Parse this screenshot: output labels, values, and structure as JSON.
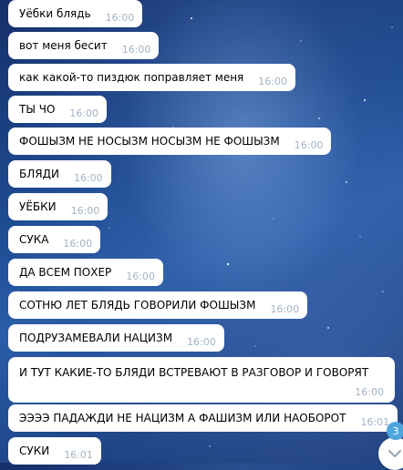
{
  "messages": [
    {
      "text": "Уёбки блядь",
      "time": "16:00"
    },
    {
      "text": "вот меня бесит",
      "time": "16:00"
    },
    {
      "text": "как какой-то пиздюк поправляет меня",
      "time": "16:00"
    },
    {
      "text": "ТЫ ЧО",
      "time": "16:00"
    },
    {
      "text": "ФОШЫЗМ НЕ НОСЫЗМ НОСЫЗМ НЕ ФОШЫЗМ",
      "time": "16:00"
    },
    {
      "text": "БЛЯДИ",
      "time": "16:00"
    },
    {
      "text": "УЁБКИ",
      "time": "16:00"
    },
    {
      "text": "СУКА",
      "time": "16:00"
    },
    {
      "text": "ДА ВСЕМ ПОХЕР",
      "time": "16:00"
    },
    {
      "text": "СОТНЮ ЛЕТ БЛЯДЬ ГОВОРИЛИ ФОШЫЗМ",
      "time": "16:00"
    },
    {
      "text": "ПОДРУЗАМЕВАЛИ НАЦИЗМ",
      "time": "16:00"
    },
    {
      "text": "И ТУТ КАКИЕ-ТО БЛЯДИ ВСТРЕВАЮТ В РАЗГОВОР И ГОВОРЯТ",
      "time": "16:00"
    },
    {
      "text": "ЭЭЭЭ ПАДАЖДИ НЕ НАЦИЗМ А ФАШИЗМ ИЛИ НАОБОРОТ",
      "time": "16:01"
    },
    {
      "text": "СУКИ",
      "time": "16:01"
    }
  ],
  "unread_badge": "3",
  "scroll_down_icon": "chevron-down-icon",
  "colors": {
    "bubble": "#ffffff",
    "time": "#a3b3c4",
    "badge": "#4ea6df"
  }
}
